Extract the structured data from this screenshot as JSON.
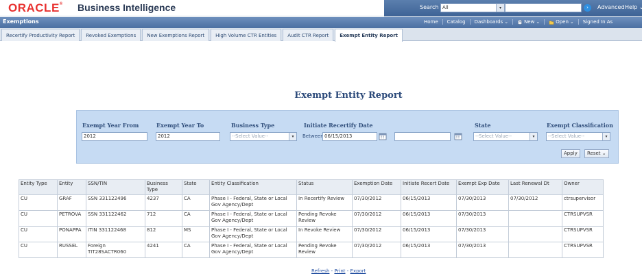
{
  "app": {
    "brand": "ORACLE",
    "product": "Business Intelligence"
  },
  "topbar": {
    "search_label": "Search",
    "search_scope": "All",
    "advanced": "Advanced",
    "help": "Help"
  },
  "header": {
    "section_title": "Exemptions"
  },
  "nav": [
    {
      "label": "Home"
    },
    {
      "label": "Catalog"
    },
    {
      "label": "Dashboards",
      "caret": "⌄"
    },
    {
      "label": "New",
      "caret": "⌄"
    },
    {
      "label": "Open",
      "caret": "⌄"
    },
    {
      "label": "Signed In As"
    }
  ],
  "tabs": [
    {
      "label": "Recertify Productivity Report"
    },
    {
      "label": "Revoked Exemptions"
    },
    {
      "label": "New Exemptions Report"
    },
    {
      "label": "High Volume CTR Entities"
    },
    {
      "label": "Audit CTR Report"
    },
    {
      "label": "Exempt Entity Report",
      "active": true
    }
  ],
  "report": {
    "title": "Exempt Entity Report",
    "prompts": {
      "exempt_year_from_label": "Exempt Year From",
      "exempt_year_from_value": "2012",
      "exempt_year_to_label": "Exempt Year To",
      "exempt_year_to_value": "2012",
      "business_type_label": "Business Type",
      "business_type_value": "--Select Value--",
      "initiate_recertify_label": "Initiate Recertify Date",
      "between_label": "Between",
      "initiate_recertify_from": "06/15/2013",
      "initiate_recertify_to": "",
      "state_label": "State",
      "state_value": "--Select Value--",
      "exempt_classification_label": "Exempt Classification",
      "exempt_classification_value": "--Select Value--",
      "apply_label": "Apply",
      "reset_label": "Reset"
    },
    "table": {
      "headers": [
        "Entity Type",
        "Entity",
        "SSN/TIN",
        "Business Type",
        "State",
        "Entity Classification",
        "Status",
        "Exemption Date",
        "Initiate Recert Date",
        "Exempt Exp Date",
        "Last Renewal Dt",
        "Owner"
      ],
      "rows": [
        [
          "CU",
          "GRAF",
          "SSN 331122496",
          "4237",
          "CA",
          "Phase I - Federal, State or Local Gov Agency/Dept",
          "In Recertify Review",
          "07/30/2012",
          "06/15/2013",
          "07/30/2013",
          "07/30/2012",
          "ctrsupervisor"
        ],
        [
          "CU",
          "PETROVA",
          "SSN 331122462",
          "712",
          "CA",
          "Phase I - Federal, State or Local Gov Agency/Dept",
          "Pending Revoke Review",
          "07/30/2012",
          "06/15/2013",
          "07/30/2013",
          "",
          "CTRSUPVSR"
        ],
        [
          "CU",
          "PONAPPA",
          "ITIN 331122468",
          "812",
          "MS",
          "Phase I - Federal, State or Local Gov Agency/Dept",
          "In Revoke Review",
          "07/30/2012",
          "06/15/2013",
          "07/30/2013",
          "",
          "CTRSUPVSR"
        ],
        [
          "CU",
          "RUSSEL",
          "Foreign TIT28SACTR060",
          "4241",
          "CA",
          "Phase I - Federal, State or Local Gov Agency/Dept",
          "Pending Revoke Review",
          "07/30/2012",
          "06/15/2013",
          "07/30/2013",
          "",
          "CTRSUPVSR"
        ]
      ]
    },
    "footer": {
      "refresh": "Refresh",
      "print": "Print",
      "export": "Export",
      "sep": " - "
    }
  }
}
